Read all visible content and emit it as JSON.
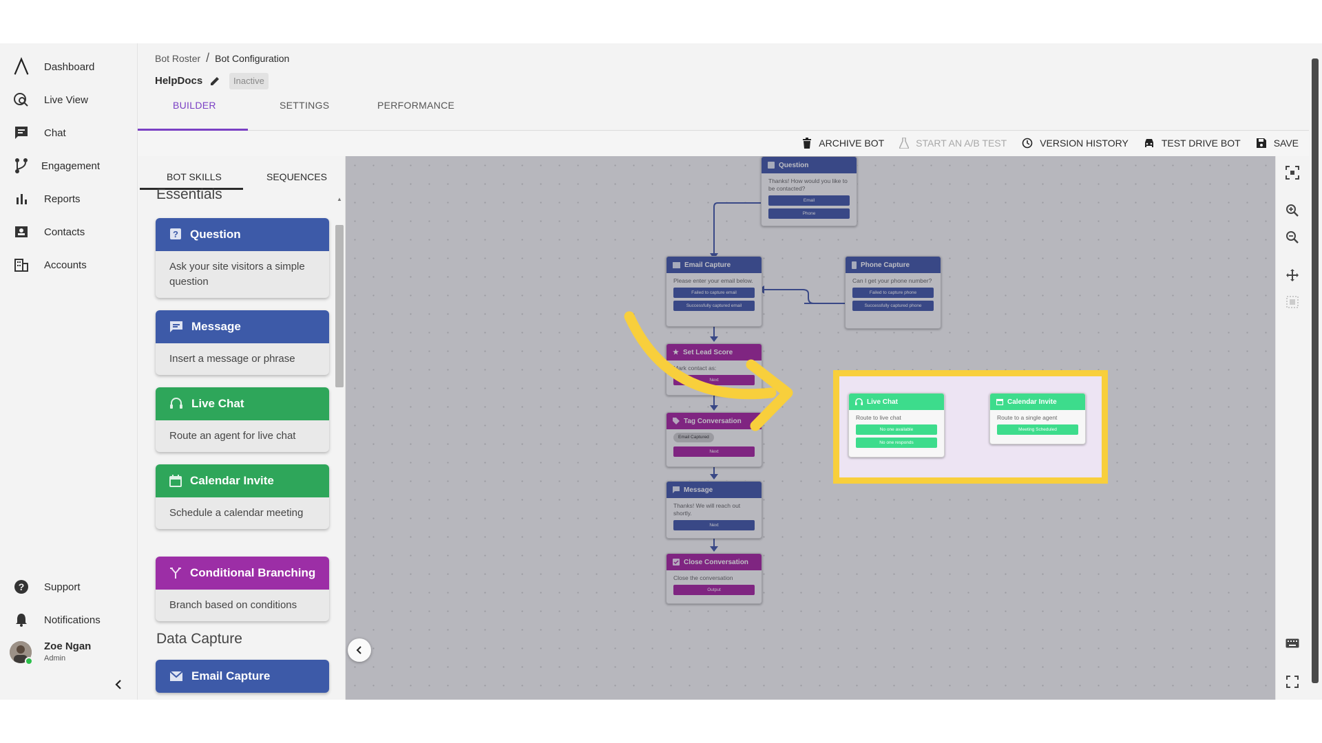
{
  "nav": {
    "items": [
      {
        "label": "Dashboard",
        "icon": "logo-icon"
      },
      {
        "label": "Live View",
        "icon": "live-view-icon"
      },
      {
        "label": "Chat",
        "icon": "chat-icon"
      },
      {
        "label": "Engagement",
        "icon": "engagement-icon"
      },
      {
        "label": "Reports",
        "icon": "reports-icon"
      },
      {
        "label": "Contacts",
        "icon": "contacts-icon"
      },
      {
        "label": "Accounts",
        "icon": "accounts-icon"
      }
    ],
    "bottom": [
      {
        "label": "Support",
        "icon": "help-icon"
      },
      {
        "label": "Notifications",
        "icon": "bell-icon"
      }
    ],
    "user": {
      "name": "Zoe Ngan",
      "role": "Admin"
    }
  },
  "breadcrumb": {
    "parent": "Bot Roster",
    "separator": "/",
    "current": "Bot Configuration"
  },
  "bot": {
    "name": "HelpDocs",
    "status": "Inactive"
  },
  "tabs": [
    {
      "label": "BUILDER",
      "active": true
    },
    {
      "label": "SETTINGS",
      "active": false
    },
    {
      "label": "PERFORMANCE",
      "active": false
    }
  ],
  "toolbar": {
    "archive": "ARCHIVE BOT",
    "ab_test": "START AN A/B TEST",
    "history": "VERSION HISTORY",
    "test_drive": "TEST DRIVE BOT",
    "save": "SAVE"
  },
  "skills_panel": {
    "tabs": [
      "BOT SKILLS",
      "SEQUENCES"
    ],
    "section_essentials": "Essentials",
    "section_data_capture": "Data Capture",
    "cards": [
      {
        "title": "Question",
        "desc": "Ask your site visitors a simple question",
        "color": "#3d5aa8"
      },
      {
        "title": "Message",
        "desc": "Insert a message or phrase",
        "color": "#3d5aa8"
      },
      {
        "title": "Live Chat",
        "desc": "Route an agent for live chat",
        "color": "#2ea65a"
      },
      {
        "title": "Calendar Invite",
        "desc": "Schedule a calendar meeting",
        "color": "#2ea65a"
      },
      {
        "title": "Conditional Branching",
        "desc": "Branch based on conditions",
        "color": "#9c2ea6"
      },
      {
        "title": "Email Capture",
        "desc": "",
        "color": "#3d5aa8"
      }
    ]
  },
  "canvas": {
    "nodes": {
      "question": {
        "title": "Question",
        "body": "Thanks! How would you like to be contacted?",
        "buttons": [
          "Email",
          "Phone"
        ]
      },
      "email_capture": {
        "title": "Email Capture",
        "body": "Please enter your email below.",
        "buttons": [
          "Failed to capture email",
          "Successfully captured email"
        ]
      },
      "phone_capture": {
        "title": "Phone Capture",
        "body": "Can I get your phone number?",
        "buttons": [
          "Failed to capture phone",
          "Successfully captured phone"
        ]
      },
      "lead_score": {
        "title": "Set Lead Score",
        "body": "Mark contact as:",
        "buttons": [
          "Next"
        ]
      },
      "tag_conversation": {
        "title": "Tag Conversation",
        "chip": "Email Captured",
        "buttons": [
          "Next"
        ]
      },
      "message": {
        "title": "Message",
        "body": "Thanks! We will reach out shortly.",
        "buttons": [
          "Next"
        ]
      },
      "close_conversation": {
        "title": "Close Conversation",
        "body": "Close the conversation",
        "buttons": [
          "Output"
        ]
      },
      "live_chat": {
        "title": "Live Chat",
        "body": "Route to live chat",
        "buttons": [
          "No one available",
          "No one responds"
        ]
      },
      "calendar_invite": {
        "title": "Calendar Invite",
        "body": "Route to a single agent",
        "buttons": [
          "Meeting Scheduled"
        ]
      }
    }
  },
  "colors": {
    "blue_node": "#4156a6",
    "purple_node": "#a5249f",
    "green_node": "#3ddc8c",
    "accent": "#7a3fc4",
    "highlight": "#f8cf3c"
  }
}
